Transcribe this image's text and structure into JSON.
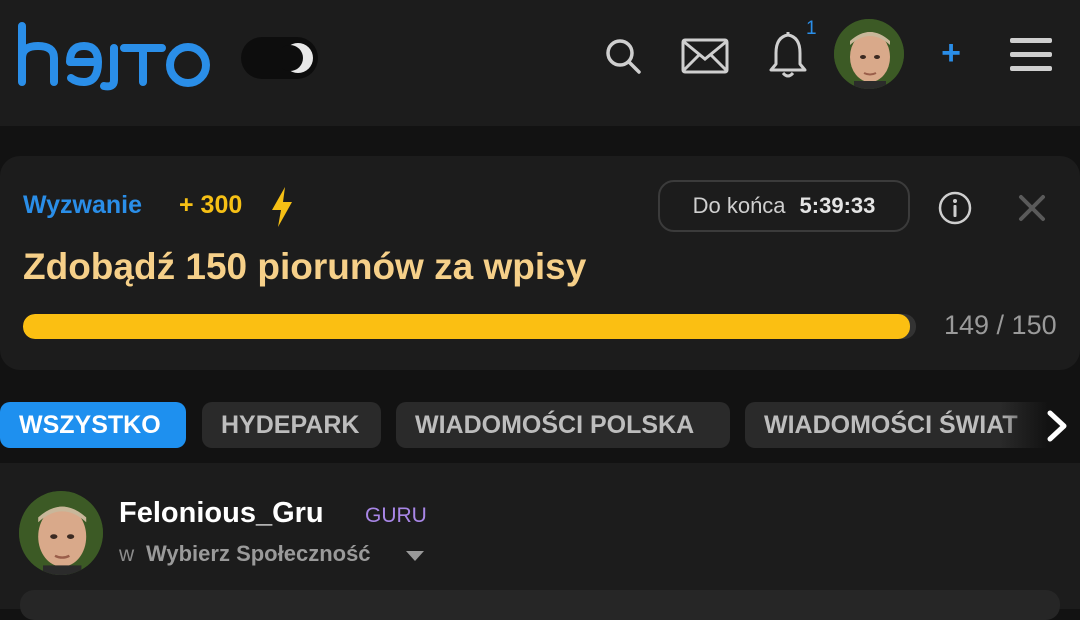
{
  "header": {
    "logo_text": "hejto",
    "icons": [
      "theme-toggle-icon",
      "search-icon",
      "mail-icon",
      "bell-icon",
      "avatar",
      "plus-icon",
      "menu-icon"
    ],
    "notification_count": "1",
    "add_label": "+"
  },
  "challenge": {
    "label": "Wyzwanie",
    "points": "+ 300",
    "timer_label": "Do końca",
    "timer_value": "5:39:33",
    "title": "Zdobądź 150 piorunów za wpisy",
    "progress_text": "149 / 150",
    "progress_fraction": 0.9933,
    "colors": {
      "label": "#2a8ee8",
      "points": "#f6c015",
      "title": "#f6d089",
      "bar": "#fbbf12"
    }
  },
  "tabs": [
    {
      "label": "WSZYSTKO",
      "active": true
    },
    {
      "label": "HYDEPARK",
      "active": false
    },
    {
      "label": "WIADOMOŚCI POLSKA",
      "active": false
    },
    {
      "label": "WIADOMOŚCI ŚWIAT",
      "active": false
    }
  ],
  "post": {
    "author": "Felonious_Gru",
    "rank": "GURU",
    "community_prefix": "w",
    "community": "Wybierz Społeczność"
  }
}
